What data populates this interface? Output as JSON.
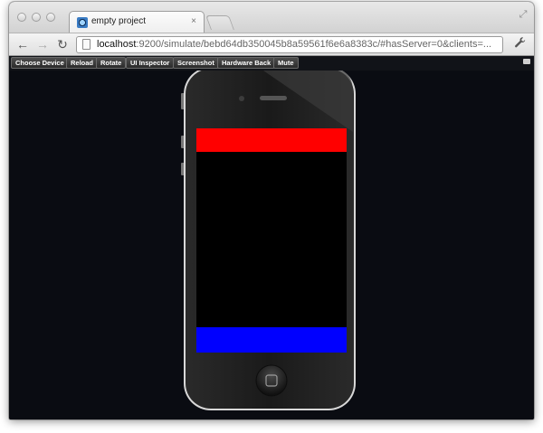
{
  "window": {
    "tab_title": "empty project",
    "tab_close_glyph": "×"
  },
  "nav": {
    "back_glyph": "←",
    "forward_glyph": "→",
    "reload_glyph": "↻",
    "url_host": "localhost",
    "url_rest": ":9200/simulate/bebd64db350045b8a59561f6e6a8383c/#hasServer=0&clients=...",
    "wrench_glyph": "🔧"
  },
  "simulator_toolbar": {
    "buttons": [
      "Choose Device",
      "Reload",
      "Rotate",
      "UI Inspector",
      "Screenshot",
      "Hardware Back",
      "Mute"
    ]
  },
  "device": {
    "top_bar_color": "#ff0000",
    "bottom_bar_color": "#0000ff",
    "screen_color": "#000000"
  },
  "icons": {
    "favicon": "app-favicon",
    "close": "close-icon",
    "new_tab": "new-tab-icon",
    "fullscreen": "fullscreen-icon",
    "back": "back-arrow-icon",
    "forward": "forward-arrow-icon",
    "reload": "reload-icon",
    "page": "page-icon",
    "wrench": "wrench-icon",
    "home_button": "home-button-icon"
  }
}
